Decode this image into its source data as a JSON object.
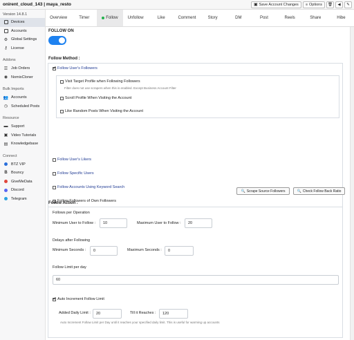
{
  "titlebar": {
    "title": "onirent_cloud_143 | maya_resto",
    "save_label": "Save Account Changes",
    "options_label": "Options",
    "icons": [
      "delete-icon",
      "back-icon",
      "pin-icon"
    ]
  },
  "sidebar": {
    "version": "Version 14.8.1",
    "main_items": [
      {
        "label": "Devices",
        "icon": "devices-icon",
        "active": true
      },
      {
        "label": "Accounts",
        "icon": "accounts-icon"
      },
      {
        "label": "Global Settings",
        "icon": "gear-icon"
      },
      {
        "label": "License",
        "icon": "key-icon"
      }
    ],
    "addons_title": "Addons",
    "addons": [
      {
        "label": "Job Orders",
        "icon": "jobs-icon"
      },
      {
        "label": "NomixCloner",
        "icon": "cloner-icon"
      }
    ],
    "bulk_title": "Bulk Imports",
    "bulk": [
      {
        "label": "Accounts",
        "icon": "users-icon"
      },
      {
        "label": "Scheduled Posts",
        "icon": "calendar-icon"
      }
    ],
    "resource_title": "Resource",
    "resources": [
      {
        "label": "Support",
        "icon": "support-icon"
      },
      {
        "label": "Video Tutorials",
        "icon": "video-icon"
      },
      {
        "label": "Knowledgebase",
        "icon": "book-icon"
      }
    ],
    "connect_title": "Connect",
    "connect": [
      {
        "label": "BTZ VIP",
        "color": "#2a6fdb"
      },
      {
        "label": "Bouncy",
        "color": "#111111"
      },
      {
        "label": "GiveMeData",
        "color": "#e0463c"
      },
      {
        "label": "Discord",
        "color": "#5865f2"
      },
      {
        "label": "Telegram",
        "color": "#2aa3e0"
      }
    ]
  },
  "tabs": [
    {
      "label": "Overview"
    },
    {
      "label": "Timer"
    },
    {
      "label": "Follow",
      "active": true
    },
    {
      "label": "Unfollow"
    },
    {
      "label": "Like"
    },
    {
      "label": "Comment"
    },
    {
      "label": "Story"
    },
    {
      "label": "DM"
    },
    {
      "label": "Post"
    },
    {
      "label": "Reels"
    },
    {
      "label": "Share"
    },
    {
      "label": "Hibe"
    }
  ],
  "main": {
    "follow_on_label": "FOLLOW ON",
    "follow_on": true,
    "follow_method_title": "Follow Method :",
    "follow_users_followers": "Follow User's Followers",
    "visit_target_profile": "Visit Target Profile when Following Followers",
    "visit_note": "Filter does not use scrapers when this is enabled. Except Business Account Filter",
    "scroll_profile": "Scroll Profile When Visiting the Account",
    "like_random_posts": "Like Random Posts When Visiting the Account",
    "follow_users_likers": "Follow User's Likers",
    "follow_specific_users": "Follow Specific Users",
    "follow_keyword": "Follow Accounts Using Keyword Search",
    "follow_own_followers": "Follow Followers of Own Followers",
    "scrape_button": "Scrape Source Followers",
    "check_ratio_button": "Check Follow Back Ratio",
    "follow_action_title": "Follow Action :",
    "follows_per_operation": "Follows per Operation",
    "min_user_label": "Minimum User to Follow :",
    "min_user_value": "10",
    "max_user_label": "Maximum User to Follow :",
    "max_user_value": "20",
    "delays_title": "Delays after Following",
    "min_seconds_label": "Minimum Seconds :",
    "min_seconds_value": "0",
    "max_seconds_label": "Maximum Seconds :",
    "max_seconds_value": "0",
    "follow_limit_label": "Follow Limit per day",
    "follow_limit_value": "60",
    "auto_increment_label": "Auto Increment Follow Limit",
    "added_daily_label": "Added Daily Limit :",
    "added_daily_value": "20",
    "till_reaches_label": "Till it Reaches :",
    "till_reaches_value": "120",
    "auto_note": "Auto Increment Follow Limit per Day until it reaches your specified daily limit. This is useful for warming up accounts"
  }
}
